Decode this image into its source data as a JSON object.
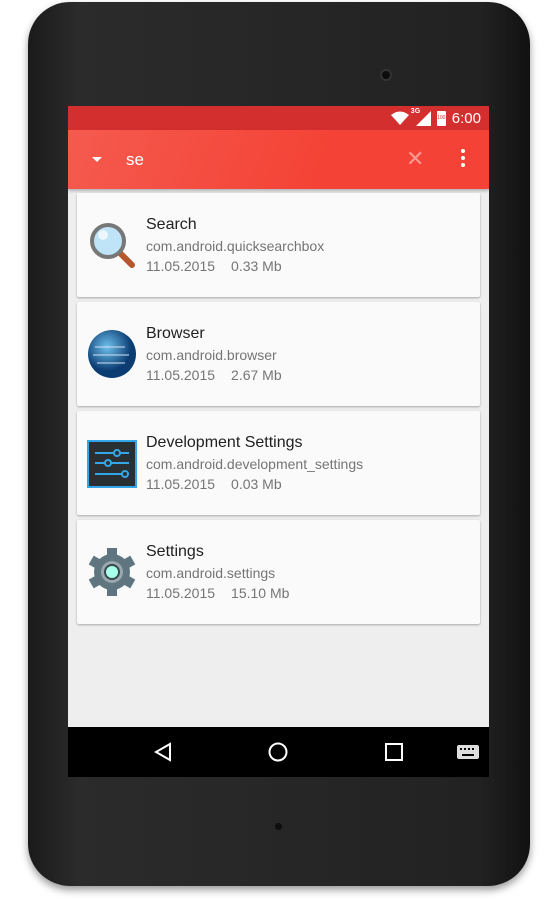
{
  "status": {
    "time": "6:00",
    "network": "3G",
    "battery": "100"
  },
  "toolbar": {
    "query": "se",
    "icons": [
      "dropdown-icon",
      "clear-icon",
      "more-icon"
    ]
  },
  "apps": [
    {
      "name": "Search",
      "package": "com.android.quicksearchbox",
      "date": "11.05.2015",
      "size": "0.33 Mb",
      "icon": "magnifier-icon"
    },
    {
      "name": "Browser",
      "package": "com.android.browser",
      "date": "11.05.2015",
      "size": "2.67 Mb",
      "icon": "globe-icon"
    },
    {
      "name": "Development Settings",
      "package": "com.android.development_settings",
      "date": "11.05.2015",
      "size": "0.03 Mb",
      "icon": "sliders-icon"
    },
    {
      "name": "Settings",
      "package": "com.android.settings",
      "date": "11.05.2015",
      "size": "15.10 Mb",
      "icon": "gear-icon"
    }
  ],
  "colors": {
    "primary": "#f44336",
    "status_bar": "#d32f2f"
  }
}
